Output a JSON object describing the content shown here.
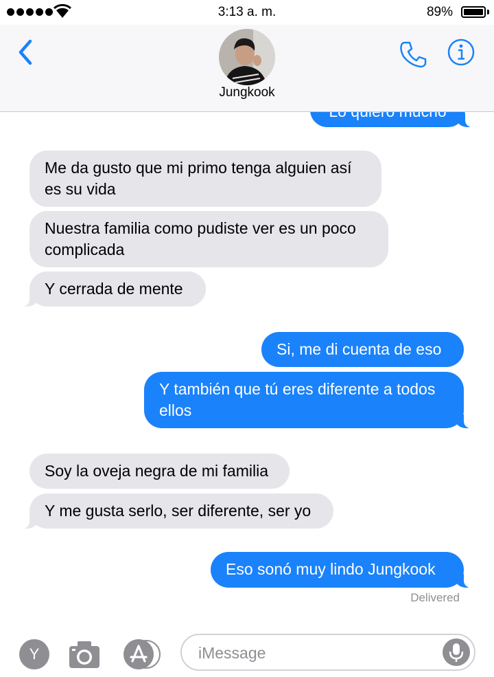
{
  "status_bar": {
    "time": "3:13 a. m.",
    "battery_percent": "89%",
    "signal_bars": 5
  },
  "header": {
    "back_icon": "chevron-left-icon",
    "contact_name": "Jungkook",
    "call_icon": "phone-icon",
    "info_icon": "info-icon"
  },
  "messages": [
    {
      "direction": "out",
      "text": "Lo quiero mucho",
      "partial": true
    },
    {
      "direction": "in",
      "text": "Me da gusto que mi primo tenga alguien así es su vida"
    },
    {
      "direction": "in",
      "text": "Nuestra familia como pudiste ver es un poco complicada"
    },
    {
      "direction": "in",
      "text": "Y cerrada de mente"
    },
    {
      "direction": "out",
      "text": "Si, me di cuenta de eso"
    },
    {
      "direction": "out",
      "text": "Y también que tú eres diferente a todos ellos"
    },
    {
      "direction": "in",
      "text": "Soy la oveja negra de mi familia"
    },
    {
      "direction": "in",
      "text": "Y me gusta serlo, ser diferente, ser yo"
    },
    {
      "direction": "out",
      "text": "Eso sonó muy lindo Jungkook"
    }
  ],
  "delivered_label": "Delivered",
  "input_bar": {
    "app_button_letter": "Y",
    "camera_icon": "camera-icon",
    "appstore_icon": "app-store-icon",
    "placeholder": "iMessage",
    "mic_icon": "microphone-icon"
  },
  "colors": {
    "outgoing_bubble": "#1a82fb",
    "incoming_bubble": "#e5e5ea",
    "accent": "#1a82fb"
  }
}
